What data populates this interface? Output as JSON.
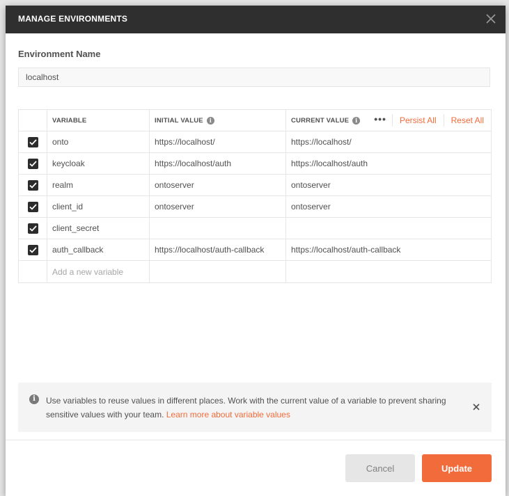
{
  "modal": {
    "title": "MANAGE ENVIRONMENTS",
    "env_name_label": "Environment Name",
    "env_name_value": "localhost"
  },
  "table": {
    "headers": {
      "variable": "VARIABLE",
      "initial_value": "INITIAL VALUE",
      "current_value": "CURRENT VALUE",
      "more_icon": "•••",
      "persist_all": "Persist All",
      "reset_all": "Reset All"
    },
    "rows": [
      {
        "checked": true,
        "variable": "onto",
        "initial": "https://localhost/",
        "current": "https://localhost/"
      },
      {
        "checked": true,
        "variable": "keycloak",
        "initial": "https://localhost/auth",
        "current": "https://localhost/auth"
      },
      {
        "checked": true,
        "variable": "realm",
        "initial": "ontoserver",
        "current": "ontoserver"
      },
      {
        "checked": true,
        "variable": "client_id",
        "initial": "ontoserver",
        "current": "ontoserver"
      },
      {
        "checked": true,
        "variable": "client_secret",
        "initial": "",
        "current": ""
      },
      {
        "checked": true,
        "variable": "auth_callback",
        "initial": "https://localhost/auth-callback",
        "current": "https://localhost/auth-callback"
      }
    ],
    "add_placeholder": "Add a new variable"
  },
  "notice": {
    "text": "Use variables to reuse values in different places. Work with the current value of a variable to prevent sharing sensitive values with your team. ",
    "link": "Learn more about variable values"
  },
  "footer": {
    "cancel_label": "Cancel",
    "update_label": "Update"
  },
  "colors": {
    "accent": "#f26b3a",
    "header_bg": "#2f2f2f"
  }
}
